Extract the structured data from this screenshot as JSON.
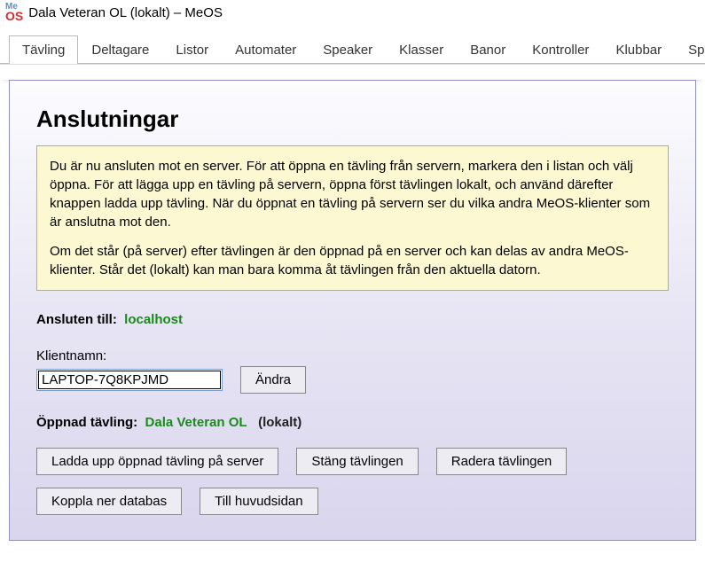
{
  "window": {
    "title": "Dala Veteran OL (lokalt) – MeOS"
  },
  "tabs": {
    "t0": "Tävling",
    "t1": "Deltagare",
    "t2": "Listor",
    "t3": "Automater",
    "t4": "Speaker",
    "t5": "Klasser",
    "t6": "Banor",
    "t7": "Kontroller",
    "t8": "Klubbar",
    "t9": "SportIdent"
  },
  "heading": "Anslutningar",
  "info": {
    "p1": "Du är nu ansluten mot en server. För att öppna en tävling från servern, markera den i listan och välj öppna. För att lägga upp en tävling på servern, öppna först tävlingen lokalt, och använd därefter knappen ladda upp tävling. När du öppnat en tävling på servern ser du vilka andra MeOS-klienter som är anslutna mot den.",
    "p2": "Om det står (på server) efter tävlingen är den öppnad på en server och kan delas av andra MeOS-klienter. Står det (lokalt) kan man bara komma åt tävlingen från den aktuella datorn."
  },
  "connected": {
    "label": "Ansluten till:",
    "value": "localhost"
  },
  "client": {
    "label": "Klientnamn:",
    "value": "LAPTOP-7Q8KPJMD",
    "changeBtn": "Ändra"
  },
  "opened": {
    "label": "Öppnad tävling:",
    "name": "Dala Veteran OL",
    "scope": "(lokalt)"
  },
  "buttons": {
    "upload": "Ladda upp öppnad tävling på server",
    "close": "Stäng tävlingen",
    "delete": "Radera tävlingen",
    "disconnect": "Koppla ner databas",
    "home": "Till huvudsidan"
  }
}
